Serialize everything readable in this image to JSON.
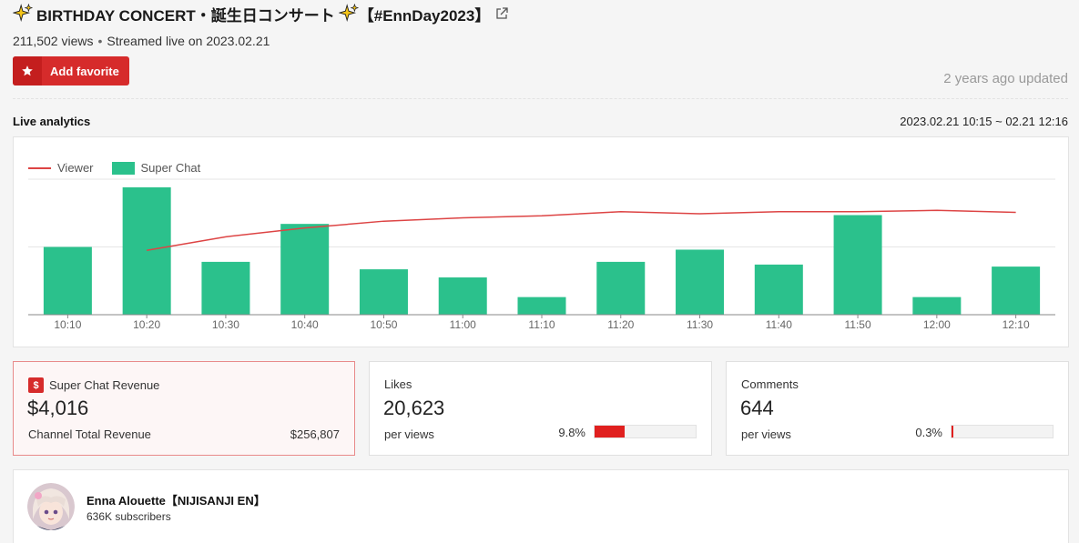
{
  "header": {
    "title": "BIRTHDAY CONCERT・誕生日コンサート",
    "title_tag": "【#EnnDay2023】",
    "views": "211,502 views",
    "streamed": "Streamed live on 2023.02.21",
    "favorite_label": "Add favorite",
    "updated": "2 years ago updated"
  },
  "analytics": {
    "title": "Live analytics",
    "range": "2023.02.21 10:15 ~ 02.21 12:16"
  },
  "chart_data": {
    "type": "bar",
    "categories": [
      "10:10",
      "10:20",
      "10:30",
      "10:40",
      "10:50",
      "11:00",
      "11:10",
      "11:20",
      "11:30",
      "11:40",
      "11:50",
      "12:00",
      "12:10"
    ],
    "series": [
      {
        "name": "Super Chat",
        "type": "bar",
        "color": "#2bc18c",
        "values": [
          100,
          188,
          78,
          134,
          67,
          55,
          26,
          78,
          96,
          74,
          147,
          26,
          71
        ]
      },
      {
        "name": "Viewer",
        "type": "line",
        "color": "#dd4444",
        "values": [
          null,
          95,
          115,
          128,
          138,
          143,
          146,
          152,
          149,
          152,
          152,
          154,
          151
        ]
      }
    ],
    "ylim": [
      0,
      200
    ],
    "grid": true,
    "legend": "top-left"
  },
  "stats": {
    "revenue": {
      "label": "Super Chat Revenue",
      "value": "$4,016",
      "sub_label": "Channel Total Revenue",
      "sub_value": "$256,807"
    },
    "likes": {
      "label": "Likes",
      "value": "20,623",
      "sub_label": "per views",
      "pct_text": "9.8%",
      "pct": 0.295
    },
    "comments": {
      "label": "Comments",
      "value": "644",
      "sub_label": "per views",
      "pct_text": "0.3%",
      "pct": 0.02
    }
  },
  "channel": {
    "name": "Enna Alouette【NIJISANJI EN】",
    "subscribers": "636K subscribers"
  },
  "colors": {
    "accent": "#d62b2b",
    "bar": "#2bc18c",
    "line": "#dd4444"
  }
}
